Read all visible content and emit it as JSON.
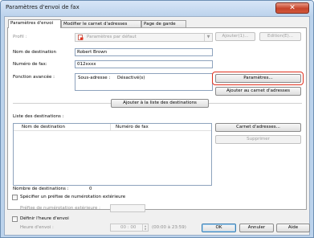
{
  "window": {
    "title": "Paramètres d'envoi de fax",
    "close_glyph": "✕"
  },
  "tabs": [
    {
      "label": "Paramètres d'envoi"
    },
    {
      "label": "Modifier le carnet d'adresses"
    },
    {
      "label": "Page de garde"
    }
  ],
  "profile": {
    "label": "Profil :",
    "value": "Paramètres par défaut",
    "add_button": "Ajouter(1)...",
    "edit_button": "Edition(E)..."
  },
  "destination_name": {
    "label": "Nom de destination",
    "value": "Robert Brown"
  },
  "fax_number": {
    "label": "Numéro de fax:",
    "value": "012xxxx"
  },
  "advanced_function": {
    "label": "Fonction avancée :",
    "subaddress_label": "Sous-adresse :",
    "subaddress_value": "Désactivé(s)",
    "settings_button": "Paramètres...",
    "add_to_address_book_button": "Ajouter au carnet d'adresses"
  },
  "add_to_list_button": "Ajouter à la liste des destinations",
  "destination_list": {
    "label": "Liste des destinations :",
    "columns": [
      "Nom de destination",
      "Numéro de fax"
    ],
    "address_book_button": "Carnet d'adresses...",
    "delete_button": "Supprimer",
    "count_label": "Nombre de destinations :",
    "count_value": "0"
  },
  "prefix": {
    "checkbox_label": "Spécifier un préfixe de numérotation extérieure",
    "field_label": "Préfixe de numérotation extérieure :",
    "value": ""
  },
  "send_time": {
    "checkbox_label": "Définir l'heure d'envoi",
    "field_label": "Heure d'envoi :",
    "value": "00 : 00",
    "range": "(00:00 à 23:59)"
  },
  "footer": {
    "ok": "OK",
    "cancel": "Annuler",
    "help": "Aide"
  },
  "colors": {
    "highlight": "#e0301e",
    "titlebar": "#bcd3ec",
    "close": "#c6442b"
  }
}
